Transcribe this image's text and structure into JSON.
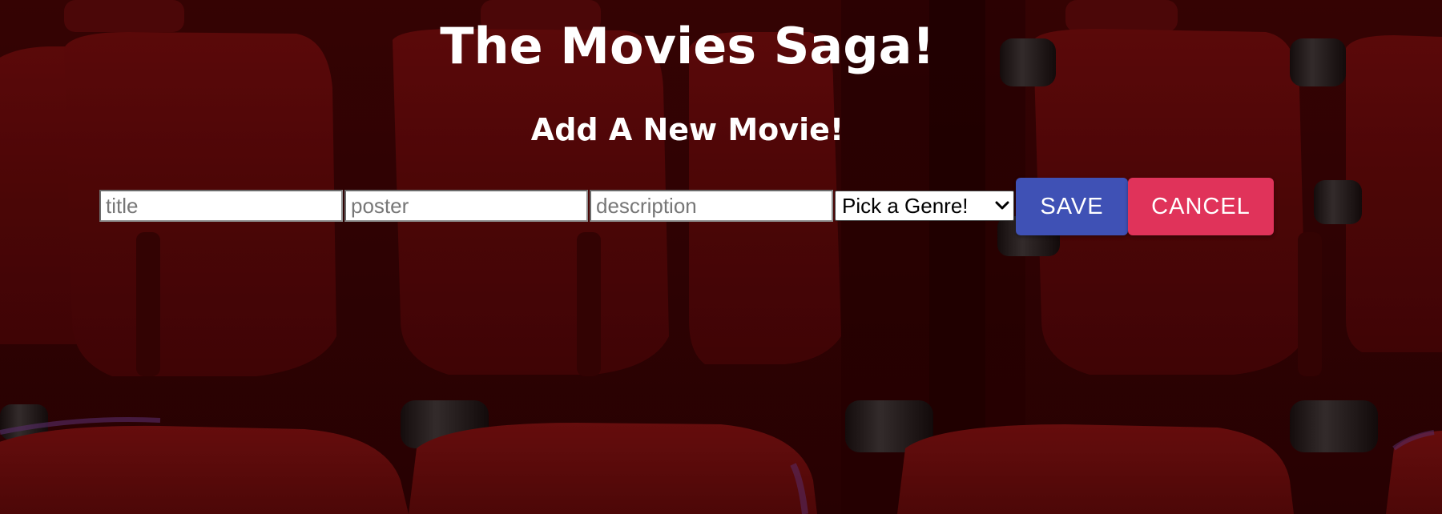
{
  "header": {
    "title": "The Movies Saga!",
    "subtitle": "Add A New Movie!"
  },
  "form": {
    "title_placeholder": "title",
    "poster_placeholder": "poster",
    "description_placeholder": "description",
    "genre_select": {
      "selected": "Pick a Genre!"
    },
    "save_label": "SAVE",
    "cancel_label": "CANCEL"
  },
  "colors": {
    "save_button": "#3f51b5",
    "cancel_button": "#e0335a",
    "seat_red": "#7a0f10",
    "background_dark": "#3a0506"
  },
  "icons": {
    "select_arrow": "chevron-down-icon"
  }
}
